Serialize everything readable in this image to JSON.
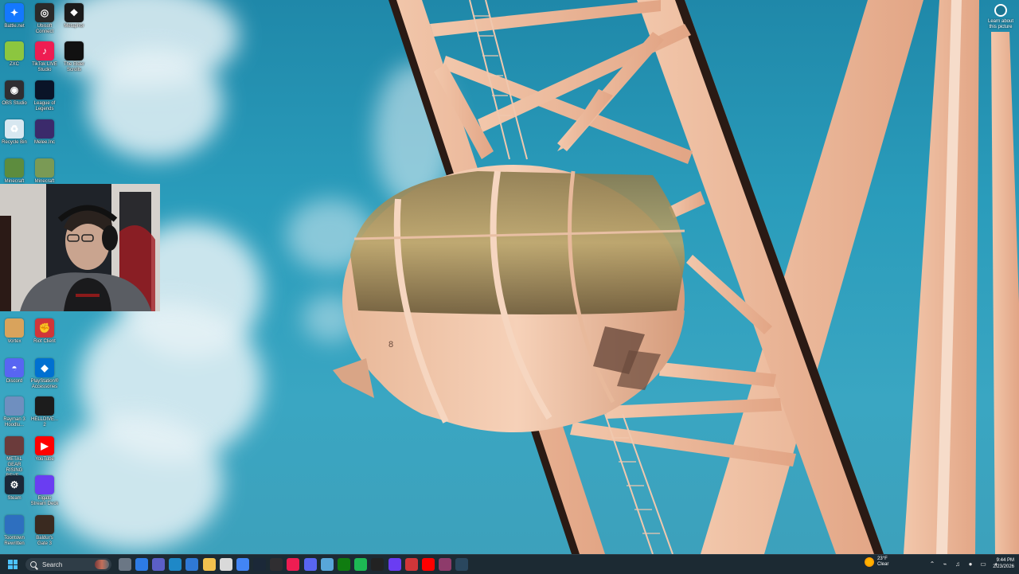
{
  "desktop": {
    "icons": [
      {
        "label": "Battle.net",
        "icon": "battlenet-icon",
        "color": "#1478ff"
      },
      {
        "label": "Ubisoft Connect",
        "icon": "ubisoft-icon",
        "color": "#2a2a2a"
      },
      {
        "label": "Metaphor",
        "icon": "paw-icon",
        "color": "#1a1a1a"
      },
      {
        "label": "ZXC",
        "icon": "zxc-icon",
        "color": "#8cc63f"
      },
      {
        "label": "TikTok LIVE Studio",
        "icon": "tiktok-icon",
        "color": "#ee1d52"
      },
      {
        "label": "The Elder Scrolls",
        "icon": "elder-scrolls-icon",
        "color": "#111111"
      },
      {
        "label": "OBS Studio",
        "icon": "obs-icon",
        "color": "#302e31"
      },
      {
        "label": "League of Legends",
        "icon": "league-icon",
        "color": "#0a1428"
      },
      {
        "label": "Recycle Bin",
        "icon": "recycle-bin-icon",
        "color": "#d7e7f0"
      },
      {
        "label": "Melee.Inc",
        "icon": "melee-icon",
        "color": "#3b2a6b"
      },
      {
        "label": "Minecraft",
        "icon": "minecraft-icon",
        "color": "#5d8c3e"
      },
      {
        "label": "Minecraft",
        "icon": "minecraft-icon",
        "color": "#7a9a55"
      },
      {
        "label": "Vortex",
        "icon": "vortex-icon",
        "color": "#d9a35c"
      },
      {
        "label": "Riot Client",
        "icon": "riot-icon",
        "color": "#d13639"
      },
      {
        "label": "Discord",
        "icon": "discord-icon",
        "color": "#5865f2"
      },
      {
        "label": "PlayStation® Accessories",
        "icon": "playstation-icon",
        "color": "#0070d1"
      },
      {
        "label": "Rayman 3 Hoodlu...",
        "icon": "rayman-icon",
        "color": "#6f8fbf"
      },
      {
        "label": "HELLDIVE... 2",
        "icon": "helldivers-icon",
        "color": "#1c1c1c"
      },
      {
        "label": "METAL GEAR RISING REVE...",
        "icon": "metal-gear-icon",
        "color": "#6b3b3b"
      },
      {
        "label": "YouTube",
        "icon": "youtube-icon",
        "color": "#ff0000"
      },
      {
        "label": "Steam",
        "icon": "steam-icon",
        "color": "#1b2838"
      },
      {
        "label": "Elgato Stream Deck",
        "icon": "stream-deck-icon",
        "color": "#6a3df2"
      },
      {
        "label": "Toontown Rewritten",
        "icon": "toontown-icon",
        "color": "#2e6fbf"
      },
      {
        "label": "Baldur's Gate 3",
        "icon": "baldurs-gate-icon",
        "color": "#3a2a20"
      }
    ],
    "widget": {
      "label": "Learn about this picture"
    }
  },
  "taskbar": {
    "search_placeholder": "Search",
    "apps": [
      {
        "icon": "file-explorer-icon",
        "color": "#6b7785"
      },
      {
        "icon": "copilot-icon",
        "color": "#2d7be5"
      },
      {
        "icon": "teams-icon",
        "color": "#5b5fc7"
      },
      {
        "icon": "edge-icon",
        "color": "#1e88c7"
      },
      {
        "icon": "store-icon",
        "color": "#2f79d6"
      },
      {
        "icon": "folder-icon",
        "color": "#f2c14e"
      },
      {
        "icon": "lightbulb-icon",
        "color": "#d9d9d9"
      },
      {
        "icon": "chrome-icon",
        "color": "#4285f4"
      },
      {
        "icon": "steam-icon",
        "color": "#1b2838"
      },
      {
        "icon": "obs-icon",
        "color": "#302e31"
      },
      {
        "icon": "tiktok-icon",
        "color": "#ee1d52"
      },
      {
        "icon": "discord-icon",
        "color": "#5865f2"
      },
      {
        "icon": "notepad-icon",
        "color": "#58a6d9"
      },
      {
        "icon": "xbox-icon",
        "color": "#107c10"
      },
      {
        "icon": "spotify-icon",
        "color": "#1db954"
      },
      {
        "icon": "capcut-icon",
        "color": "#222222"
      },
      {
        "icon": "stream-deck-icon",
        "color": "#6a3df2"
      },
      {
        "icon": "riot-icon",
        "color": "#d13639"
      },
      {
        "icon": "youtube-icon",
        "color": "#ff0000"
      },
      {
        "icon": "app-icon",
        "color": "#8e3b6b"
      },
      {
        "icon": "steam-icon",
        "color": "#2a475e"
      }
    ],
    "weather": {
      "temp": "23°F",
      "condition": "Clear"
    },
    "tray": [
      "chevron-up-icon",
      "network-icon",
      "speaker-icon",
      "mic-icon",
      "battery-icon",
      "volume-icon"
    ],
    "time": "9:44 PM",
    "date": "2/23/2026"
  }
}
